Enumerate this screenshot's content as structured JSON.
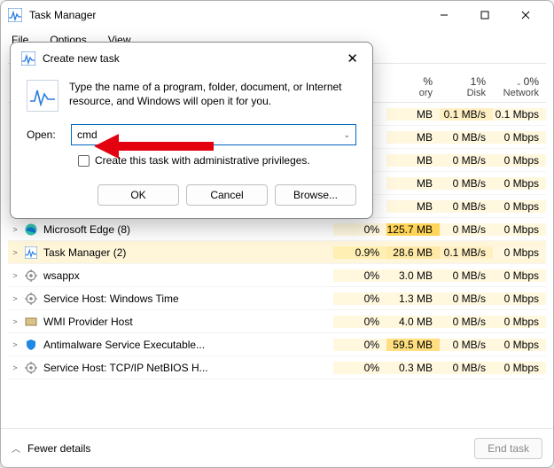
{
  "window": {
    "title": "Task Manager",
    "menu": {
      "file": "File",
      "options": "Options",
      "view": "View"
    }
  },
  "columns": {
    "memory": {
      "pct": "%",
      "label": "ory"
    },
    "disk": {
      "pct": "1%",
      "label": "Disk"
    },
    "network": {
      "pct": "0%",
      "label": "Network"
    }
  },
  "rows": [
    {
      "name": "",
      "cpu": "",
      "mem": "MB",
      "disk": "0.1 MB/s",
      "net": "0.1 Mbps",
      "icon": ""
    },
    {
      "name": "",
      "cpu": "",
      "mem": "MB",
      "disk": "0 MB/s",
      "net": "0 Mbps",
      "icon": ""
    },
    {
      "name": "",
      "cpu": "",
      "mem": "MB",
      "disk": "0 MB/s",
      "net": "0 Mbps",
      "icon": ""
    },
    {
      "name": "",
      "cpu": "",
      "mem": "MB",
      "disk": "0 MB/s",
      "net": "0 Mbps",
      "icon": ""
    },
    {
      "name": "",
      "cpu": "",
      "mem": "MB",
      "disk": "0 MB/s",
      "net": "0 Mbps",
      "icon": ""
    },
    {
      "name": "Microsoft Edge (8)",
      "cpu": "0%",
      "mem": "125.7 MB",
      "disk": "0 MB/s",
      "net": "0 Mbps",
      "icon": "edge"
    },
    {
      "name": "Task Manager (2)",
      "cpu": "0.9%",
      "mem": "28.6 MB",
      "disk": "0.1 MB/s",
      "net": "0 Mbps",
      "icon": "tm",
      "sel": true
    },
    {
      "name": "wsappx",
      "cpu": "0%",
      "mem": "3.0 MB",
      "disk": "0 MB/s",
      "net": "0 Mbps",
      "icon": "gear"
    },
    {
      "name": "Service Host: Windows Time",
      "cpu": "0%",
      "mem": "1.3 MB",
      "disk": "0 MB/s",
      "net": "0 Mbps",
      "icon": "gear"
    },
    {
      "name": "WMI Provider Host",
      "cpu": "0%",
      "mem": "4.0 MB",
      "disk": "0 MB/s",
      "net": "0 Mbps",
      "icon": "wmi"
    },
    {
      "name": "Antimalware Service Executable...",
      "cpu": "0%",
      "mem": "59.5 MB",
      "disk": "0 MB/s",
      "net": "0 Mbps",
      "icon": "shield"
    },
    {
      "name": "Service Host: TCP/IP NetBIOS H...",
      "cpu": "0%",
      "mem": "0.3 MB",
      "disk": "0 MB/s",
      "net": "0 Mbps",
      "icon": "gear"
    }
  ],
  "footer": {
    "fewer": "Fewer details",
    "endtask": "End task"
  },
  "dialog": {
    "title": "Create new task",
    "desc": "Type the name of a program, folder, document, or Internet resource, and Windows will open it for you.",
    "open_label": "Open:",
    "open_value": "cmd",
    "check_label": "Create this task with administrative privileges.",
    "ok": "OK",
    "cancel": "Cancel",
    "browse": "Browse..."
  }
}
